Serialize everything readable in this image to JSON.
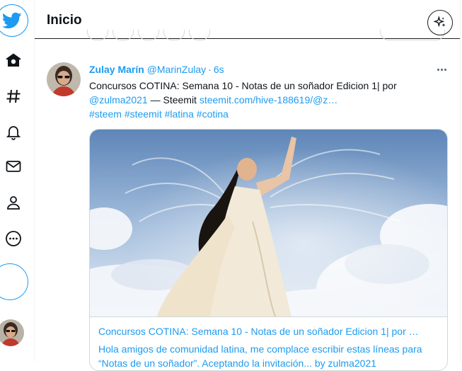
{
  "header": {
    "title": "Inicio"
  },
  "nav": {
    "items": [
      "twitter-logo",
      "home-icon",
      "hashtag-icon",
      "bell-icon",
      "mail-icon",
      "profile-icon",
      "more-icon",
      "tweet-button"
    ]
  },
  "tweet": {
    "author_name": "Zulay Marín",
    "author_handle": "@MarinZulay",
    "separator": "·",
    "time": "6s",
    "text_part1": "Concursos COTINA: Semana 10 - Notas de un soñador Edicion 1| por",
    "mention": "@zulma2021",
    "text_part2": " — Steemit ",
    "link": "steemit.com/hive-188619/@z…",
    "hashtags": [
      "#steem",
      "#steemit",
      "#latina",
      "#cotina"
    ],
    "card": {
      "title": "Concursos COTINA: Semana 10 - Notas de un soñador Edicion 1| por …",
      "description": "Hola amigos de comunidad latina, me complace escribir estas líneas para “Notas de un soñador”. Aceptando la invitación... by zulma2021"
    }
  },
  "colors": {
    "accent": "#1d9bf0",
    "text": "#0f1419",
    "muted": "#536471"
  }
}
